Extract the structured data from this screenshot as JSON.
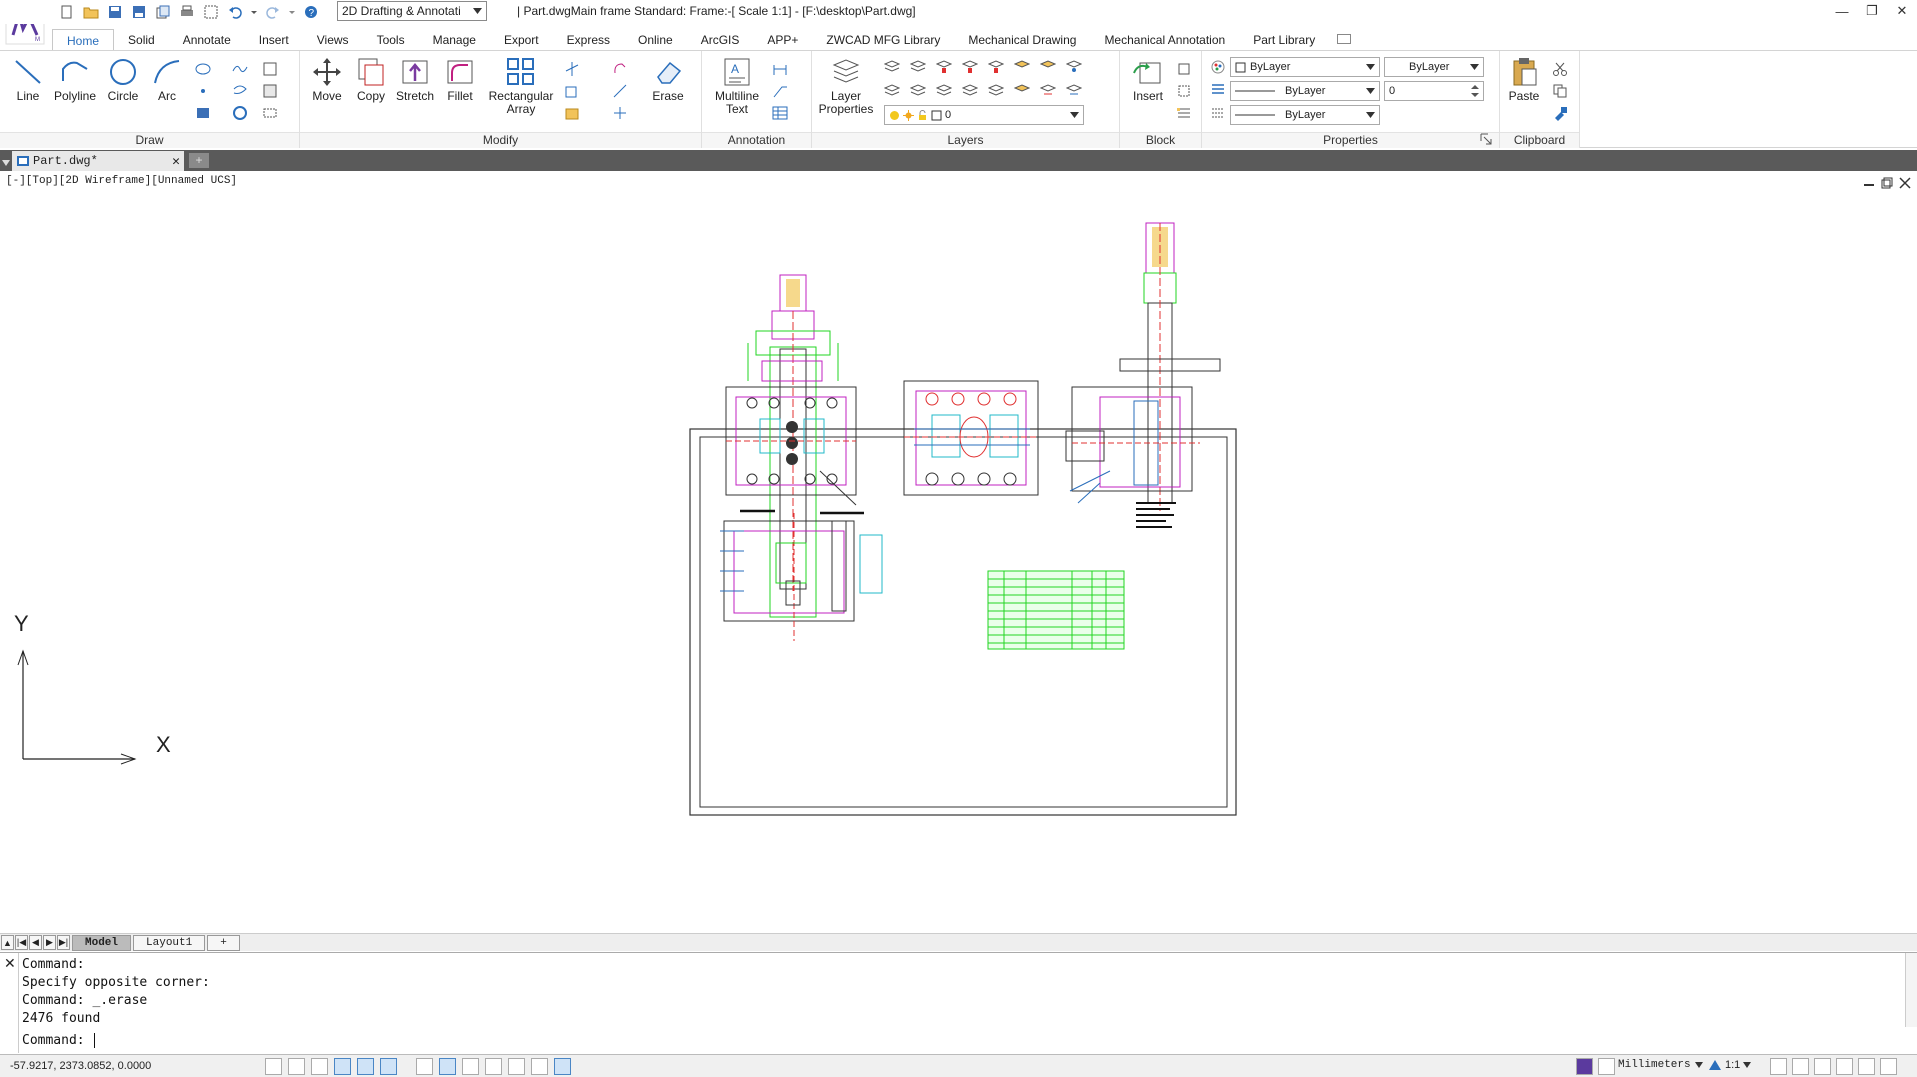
{
  "app": {
    "workspace": "2D Drafting & Annotati",
    "title": "| Part.dwgMain frame  Standard: Frame:-[ Scale 1:1] - [F:\\desktop\\Part.dwg]"
  },
  "tabs": [
    "Home",
    "Solid",
    "Annotate",
    "Insert",
    "Views",
    "Tools",
    "Manage",
    "Export",
    "Express",
    "Online",
    "ArcGIS",
    "APP+",
    "ZWCAD MFG Library",
    "Mechanical Drawing",
    "Mechanical Annotation",
    "Part Library"
  ],
  "ribbon": {
    "draw": {
      "title": "Draw",
      "line": "Line",
      "polyline": "Polyline",
      "circle": "Circle",
      "arc": "Arc"
    },
    "modify": {
      "title": "Modify",
      "move": "Move",
      "copy": "Copy",
      "stretch": "Stretch",
      "fillet": "Fillet",
      "rect_array_1": "Rectangular",
      "rect_array_2": "Array",
      "erase": "Erase"
    },
    "annotation": {
      "title": "Annotation",
      "mtext_1": "Multiline",
      "mtext_2": "Text"
    },
    "layers": {
      "title": "Layers",
      "props_1": "Layer",
      "props_2": "Properties",
      "current_layer": "0"
    },
    "block": {
      "title": "Block",
      "insert": "Insert"
    },
    "properties": {
      "title": "Properties",
      "color": "ByLayer",
      "linetype": "ByLayer",
      "lineweight": "ByLayer",
      "plotstyle": "ByLayer",
      "transparency": "0"
    },
    "clipboard": {
      "title": "Clipboard",
      "paste": "Paste"
    }
  },
  "document": {
    "tab_label": "Part.dwg*",
    "add_tab": "+"
  },
  "viewport": {
    "label": "[-][Top][2D Wireframe][Unnamed UCS]",
    "ucs_y": "Y",
    "ucs_x": "X"
  },
  "layouts": {
    "model": "Model",
    "layout1": "Layout1",
    "add": "+"
  },
  "command": {
    "history": [
      "Command:",
      "Specify opposite corner:",
      "Command: _.erase",
      "2476 found"
    ],
    "prompt": "Command:"
  },
  "status": {
    "coords": "-57.9217, 2373.0852, 0.0000",
    "units": "Millimeters",
    "scale": "1:1"
  },
  "colors": {
    "accent": "#2a6ebb",
    "docbar": "#5a5a5a",
    "green": "#22d422",
    "magenta": "#c020c0",
    "red": "#e03030",
    "cyan": "#20b8c8"
  }
}
